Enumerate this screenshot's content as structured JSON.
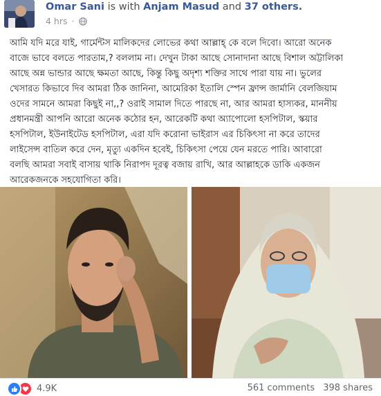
{
  "post": {
    "author": "Omar Sani",
    "with_text": "is with",
    "tagged": "Anjam Masud",
    "and_text": "and",
    "others": "37 others.",
    "time": "4 hrs",
    "privacy_icon": "globe-icon"
  },
  "body": {
    "lines": [
      "আমি যদি মরে যাই, গার্মেন্টস মালিকদের লোভের কথা আল্লাহ্‌ কে বলে দিবো। আরো অনেক",
      "বাজে ভাবে বলতে পারতাম,? বললাম না। দেখুন টাকা আছে সোনাদানা আছে বিশাল অট্টালিকা",
      "আছে অন্ন ভান্ডার আছে ক্ষমতা আছে, কিন্তু কিছু অদৃশ্য শক্তির সাথে পারা যায় না। ভুলের",
      "খেসারত কিভাবে দিব আমরা ঠিক জানিনা, আমেরিকা ইতালি স্পেন ফ্রান্স জার্মানি বেলজিয়াম",
      "ওদের সামনে আমরা কিছুই না,,? ওরাই সামাল দিতে পারছে না, আর আমরা হাস্যকর, মাননীয়",
      "প্রধানমন্ত্রী আপনি আরো অনেক কঠোর হন, আরেকটি কথা অ্যাপোলো হসপিটাল, স্কয়ার",
      "হসপিটাল, ইউনাইটেড হসপিটাল, এরা যদি করোনা ভাইরাস এর চিকিৎসা না করে তাদের",
      "লাইসেন্স বাতিল করে দেন, মৃত্যু একদিন হবেই, চিকিৎসা পেয়ে যেন মরতে পারি। আবারো",
      "বলছি আমরা সবাই বাসায় থাকি নিরাপদ দূরত্ব বজায় রাখি, আর আল্লাহকে ডাকি একজন",
      "আরেকজনকে সহযোগিতা করি।"
    ]
  },
  "footer": {
    "reactions_count": "4.9K",
    "comments": "561 comments",
    "shares": "398 shares"
  },
  "colors": {
    "link": "#385898",
    "like": "#2e7cf6",
    "love": "#f0384a",
    "text": "#1d2129",
    "muted": "#90949c"
  }
}
